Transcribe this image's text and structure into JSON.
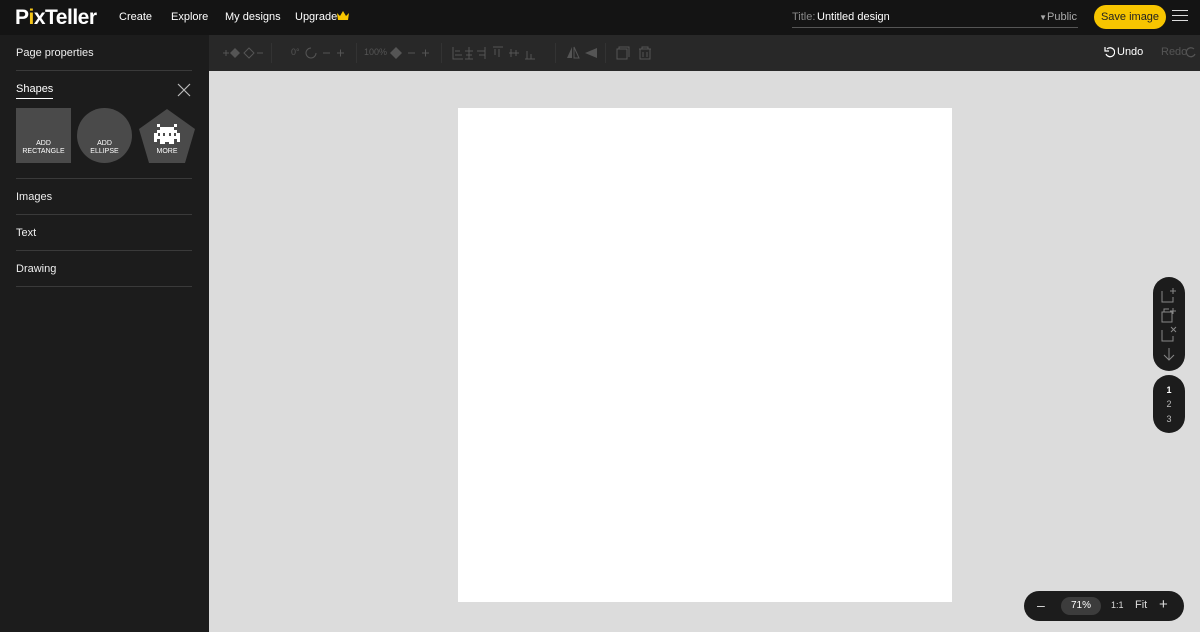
{
  "app": {
    "logo": "PixTeller"
  },
  "nav": {
    "create": "Create",
    "explore": "Explore",
    "my_designs": "My designs",
    "upgrade": "Upgrade"
  },
  "title_field": {
    "label": "Title:",
    "value": "Untitled design",
    "visibility": "Public"
  },
  "actions": {
    "save": "Save image",
    "undo": "Undo",
    "redo": "Redo"
  },
  "sidebar": {
    "page_properties": "Page properties",
    "shapes": {
      "title": "Shapes",
      "rectangle_line1": "ADD",
      "rectangle_line2": "RECTANGLE",
      "ellipse_line1": "ADD",
      "ellipse_line2": "ELLIPSE",
      "more": "MORE"
    },
    "images": "Images",
    "text": "Text",
    "drawing": "Drawing"
  },
  "toolbar": {
    "rotation": "0°",
    "opacity": "100%"
  },
  "pages": {
    "items": [
      "1",
      "2",
      "3"
    ],
    "active": "1"
  },
  "zoom": {
    "level": "71%",
    "one_to_one": "1:1",
    "fit": "Fit"
  },
  "colors": {
    "accent": "#f7c500",
    "topbar": "#141414",
    "sidebar": "#1c1c1c",
    "workspace": "#dcdcdc"
  }
}
